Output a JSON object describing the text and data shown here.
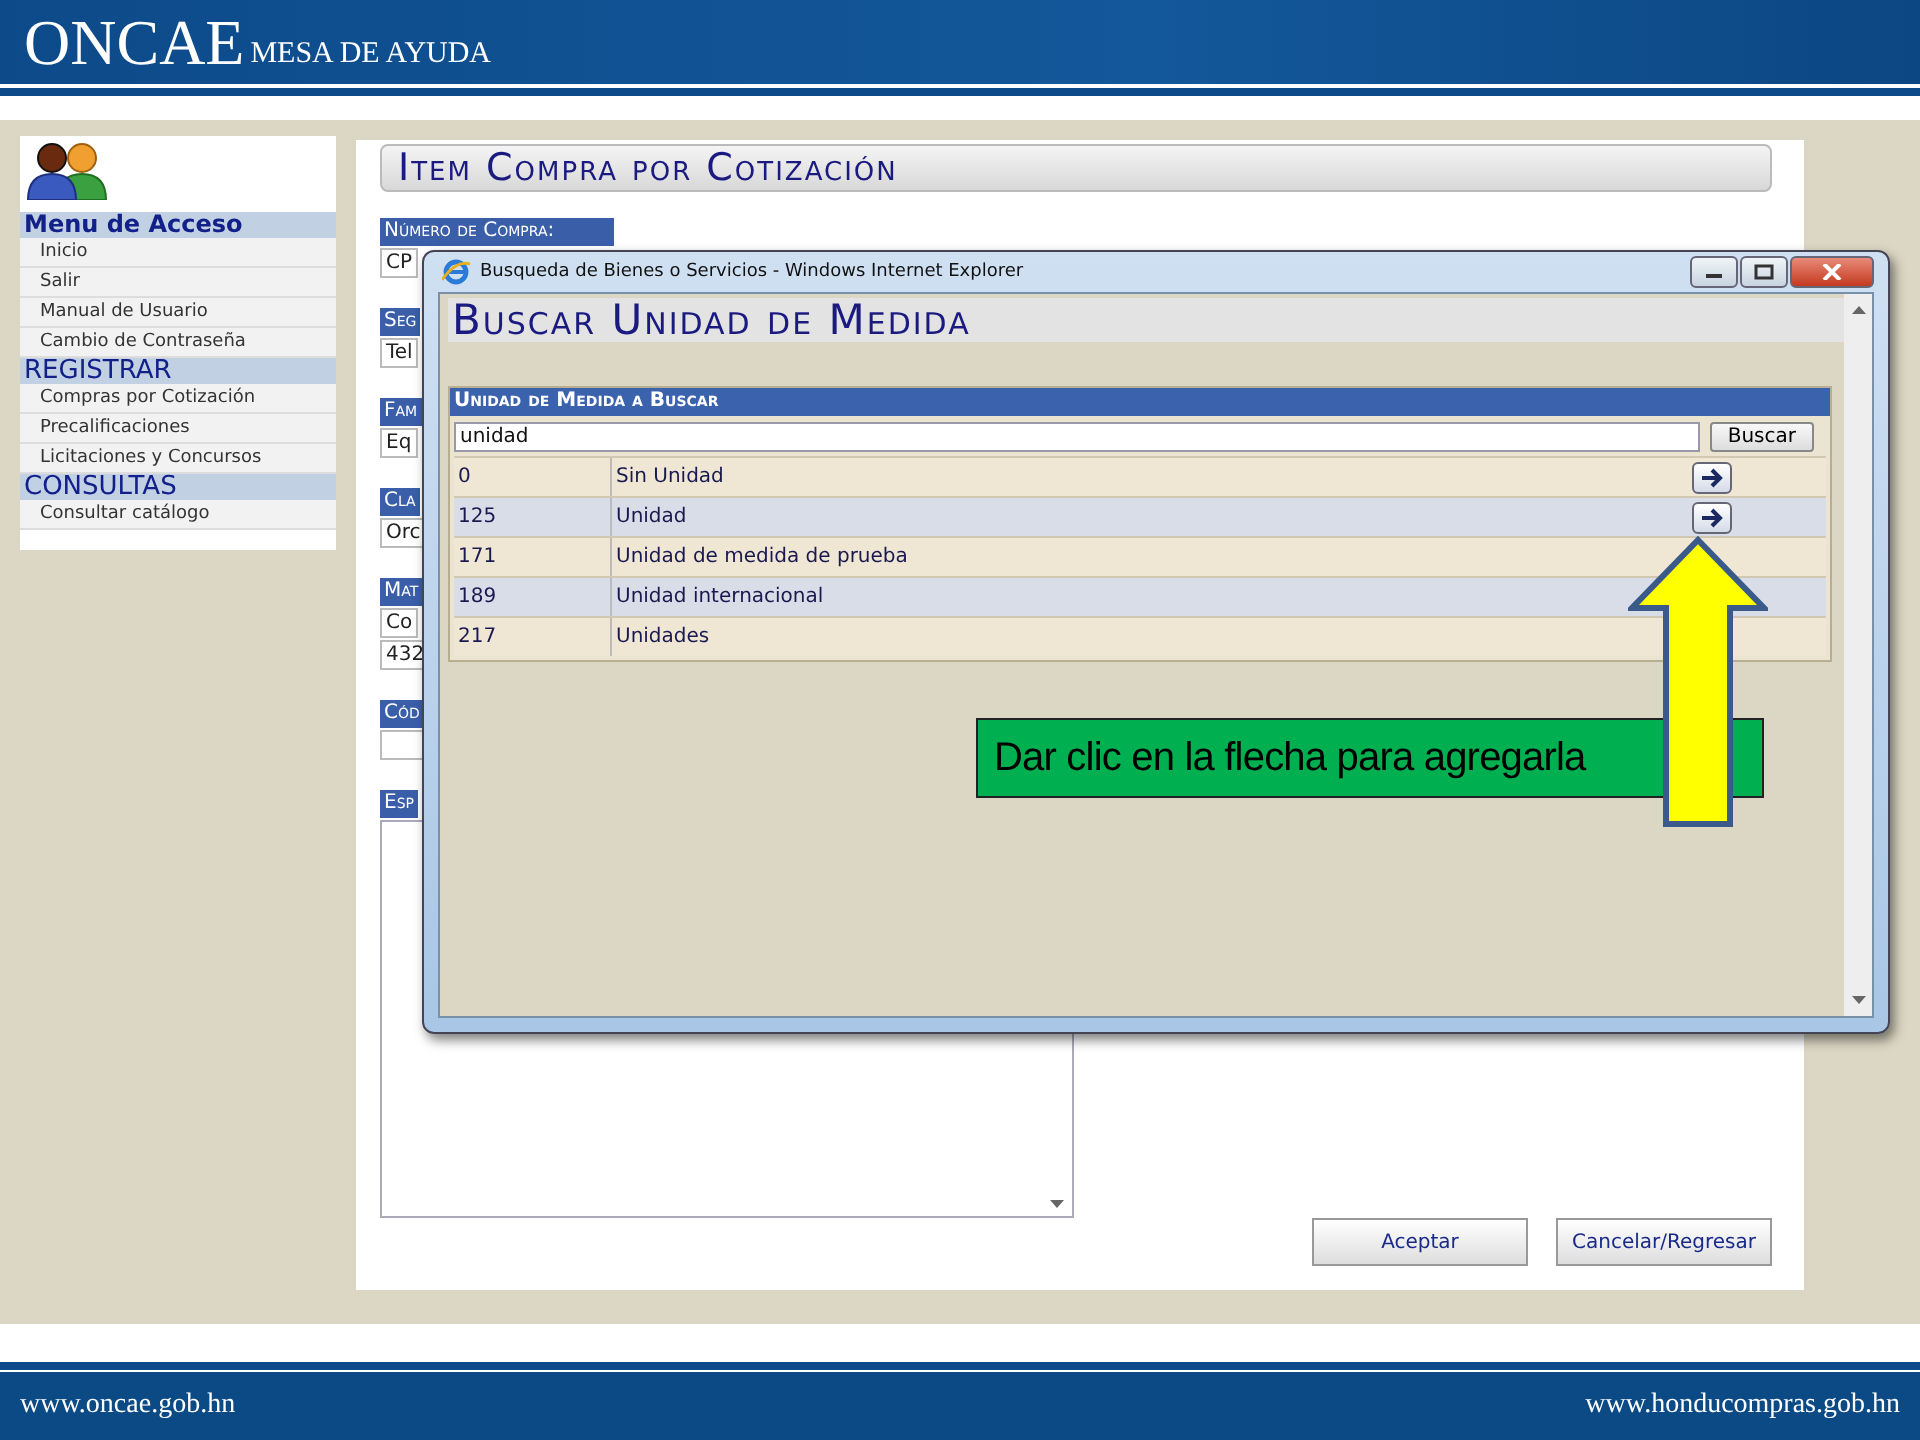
{
  "header": {
    "logo": "ONCAE",
    "subtitle": "MESA DE AYUDA"
  },
  "sidebar": {
    "sections": [
      {
        "title": "Menu de Acceso",
        "kind": "heading",
        "items": [
          "Inicio",
          "Salir",
          "Manual de Usuario",
          "Cambio de Contraseña"
        ]
      },
      {
        "title": "REGISTRAR",
        "kind": "section",
        "items": [
          "Compras por Cotización",
          "Precalificaciones",
          "Licitaciones y Concursos"
        ]
      },
      {
        "title": "CONSULTAS",
        "kind": "section",
        "items": [
          "Consultar catálogo"
        ]
      }
    ]
  },
  "form": {
    "title": "Item Compra por Cotización",
    "fields": [
      {
        "label": "Número de Compra:",
        "kind": "input",
        "values": [
          "CP"
        ]
      },
      {
        "label": "Seg",
        "kind": "input",
        "values": [
          "Tel"
        ]
      },
      {
        "label": "Fam",
        "kind": "input",
        "values": [
          "Eq"
        ]
      },
      {
        "label": "Cla",
        "kind": "input",
        "values": [
          "Orc"
        ]
      },
      {
        "label": "Mat",
        "kind": "input",
        "values": [
          "Co",
          "432"
        ]
      },
      {
        "label": "Cód",
        "kind": "empty"
      },
      {
        "label": "Esp",
        "kind": "textarea"
      }
    ],
    "buttons": [
      "Aceptar",
      "Cancelar/Regresar"
    ]
  },
  "popup": {
    "window_title": "Busqueda de Bienes o Servicios - Windows Internet Explorer",
    "heading": "Buscar Unidad de Medida",
    "search": {
      "label": "Unidad de Medida a Buscar",
      "value": "unidad",
      "button": "Buscar"
    },
    "rows": [
      {
        "code": "0",
        "name": "Sin Unidad",
        "has_action": true
      },
      {
        "code": "125",
        "name": "Unidad",
        "has_action": true
      },
      {
        "code": "171",
        "name": "Unidad de medida de prueba",
        "has_action": false
      },
      {
        "code": "189",
        "name": "Unidad internacional",
        "has_action": false
      },
      {
        "code": "217",
        "name": "Unidades",
        "has_action": false
      }
    ]
  },
  "callout": {
    "text": "Dar clic en la flecha para agregarla"
  },
  "footer": {
    "left": "www.oncae.gob.hn",
    "right": "www.honducompras.gob.hn"
  }
}
